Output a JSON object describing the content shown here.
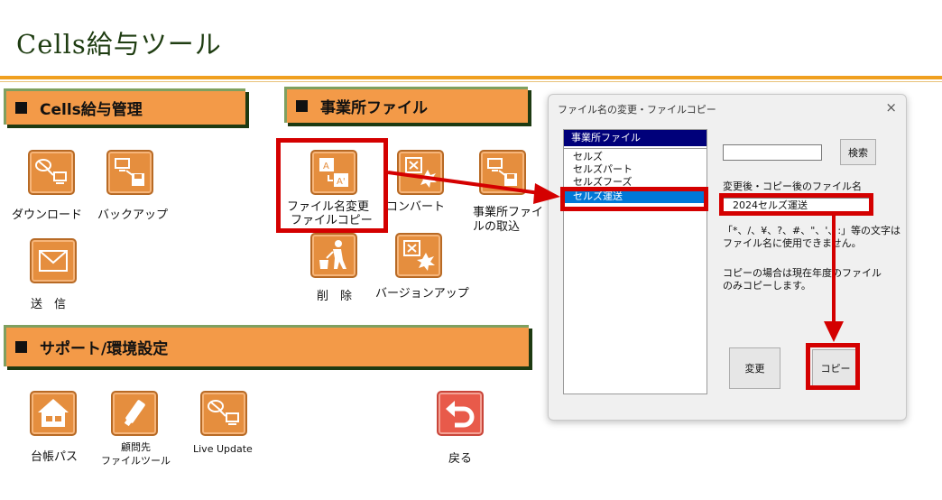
{
  "app": {
    "title": "Cells給与ツール"
  },
  "sections": {
    "payroll": "Cells給与管理",
    "office_files": "事業所ファイル",
    "support": "サポート/環境設定"
  },
  "tiles": {
    "download": "ダウンロード",
    "backup": "バックアップ",
    "send": "送　信",
    "rename_line1": "ファイル名変更",
    "rename_line2": "ファイルコピー",
    "convert": "コンバート",
    "import_line1": "事業所ファイ",
    "import_line2": "ルの取込",
    "delete": "削　除",
    "version_up": "バージョンアップ",
    "ledger_path": "台帳パス",
    "advisor_line1": "顧問先",
    "advisor_line2": "ファイルツール",
    "live_update": "Live Update",
    "back": "戻る"
  },
  "dialog": {
    "title": "ファイル名の変更・ファイルコピー",
    "close": "×",
    "list_header": "事業所ファイル",
    "items": [
      "セルズ",
      "セルズパート",
      "セルズフーズ",
      "セルズ運送"
    ],
    "selected_index": 3,
    "search_button": "検索",
    "new_name_label": "変更後・コピー後のファイル名",
    "new_name_value": "2024セルズ運送",
    "note1_line1": "「*、/、¥、?、#、\"、'、:」等の文字は",
    "note1_line2": "ファイル名に使用できません。",
    "note2_line1": "コピーの場合は現在年度のファイル",
    "note2_line2": "のみコピーします。",
    "change_button": "変更",
    "copy_button": "コピー"
  },
  "colors": {
    "accent": "#f39a48",
    "highlight": "#d40000",
    "selection": "#0078d7",
    "list_header": "#00007a"
  }
}
